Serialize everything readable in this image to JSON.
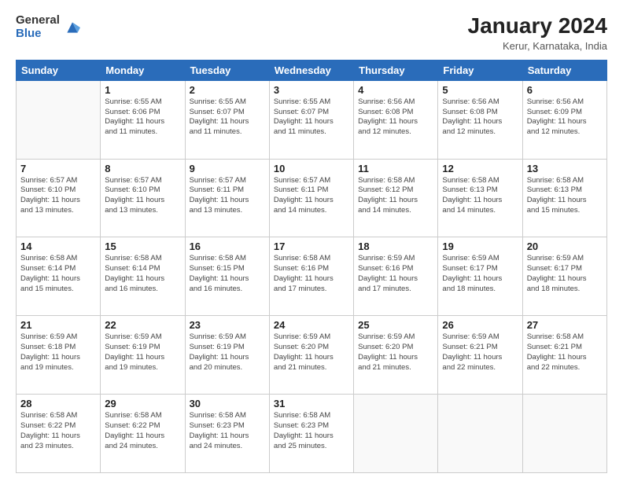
{
  "logo": {
    "general": "General",
    "blue": "Blue"
  },
  "title": "January 2024",
  "subtitle": "Kerur, Karnataka, India",
  "days_of_week": [
    "Sunday",
    "Monday",
    "Tuesday",
    "Wednesday",
    "Thursday",
    "Friday",
    "Saturday"
  ],
  "weeks": [
    [
      {
        "day": "",
        "info": ""
      },
      {
        "day": "1",
        "info": "Sunrise: 6:55 AM\nSunset: 6:06 PM\nDaylight: 11 hours\nand 11 minutes."
      },
      {
        "day": "2",
        "info": "Sunrise: 6:55 AM\nSunset: 6:07 PM\nDaylight: 11 hours\nand 11 minutes."
      },
      {
        "day": "3",
        "info": "Sunrise: 6:55 AM\nSunset: 6:07 PM\nDaylight: 11 hours\nand 11 minutes."
      },
      {
        "day": "4",
        "info": "Sunrise: 6:56 AM\nSunset: 6:08 PM\nDaylight: 11 hours\nand 12 minutes."
      },
      {
        "day": "5",
        "info": "Sunrise: 6:56 AM\nSunset: 6:08 PM\nDaylight: 11 hours\nand 12 minutes."
      },
      {
        "day": "6",
        "info": "Sunrise: 6:56 AM\nSunset: 6:09 PM\nDaylight: 11 hours\nand 12 minutes."
      }
    ],
    [
      {
        "day": "7",
        "info": "Sunrise: 6:57 AM\nSunset: 6:10 PM\nDaylight: 11 hours\nand 13 minutes."
      },
      {
        "day": "8",
        "info": "Sunrise: 6:57 AM\nSunset: 6:10 PM\nDaylight: 11 hours\nand 13 minutes."
      },
      {
        "day": "9",
        "info": "Sunrise: 6:57 AM\nSunset: 6:11 PM\nDaylight: 11 hours\nand 13 minutes."
      },
      {
        "day": "10",
        "info": "Sunrise: 6:57 AM\nSunset: 6:11 PM\nDaylight: 11 hours\nand 14 minutes."
      },
      {
        "day": "11",
        "info": "Sunrise: 6:58 AM\nSunset: 6:12 PM\nDaylight: 11 hours\nand 14 minutes."
      },
      {
        "day": "12",
        "info": "Sunrise: 6:58 AM\nSunset: 6:13 PM\nDaylight: 11 hours\nand 14 minutes."
      },
      {
        "day": "13",
        "info": "Sunrise: 6:58 AM\nSunset: 6:13 PM\nDaylight: 11 hours\nand 15 minutes."
      }
    ],
    [
      {
        "day": "14",
        "info": "Sunrise: 6:58 AM\nSunset: 6:14 PM\nDaylight: 11 hours\nand 15 minutes."
      },
      {
        "day": "15",
        "info": "Sunrise: 6:58 AM\nSunset: 6:14 PM\nDaylight: 11 hours\nand 16 minutes."
      },
      {
        "day": "16",
        "info": "Sunrise: 6:58 AM\nSunset: 6:15 PM\nDaylight: 11 hours\nand 16 minutes."
      },
      {
        "day": "17",
        "info": "Sunrise: 6:58 AM\nSunset: 6:16 PM\nDaylight: 11 hours\nand 17 minutes."
      },
      {
        "day": "18",
        "info": "Sunrise: 6:59 AM\nSunset: 6:16 PM\nDaylight: 11 hours\nand 17 minutes."
      },
      {
        "day": "19",
        "info": "Sunrise: 6:59 AM\nSunset: 6:17 PM\nDaylight: 11 hours\nand 18 minutes."
      },
      {
        "day": "20",
        "info": "Sunrise: 6:59 AM\nSunset: 6:17 PM\nDaylight: 11 hours\nand 18 minutes."
      }
    ],
    [
      {
        "day": "21",
        "info": "Sunrise: 6:59 AM\nSunset: 6:18 PM\nDaylight: 11 hours\nand 19 minutes."
      },
      {
        "day": "22",
        "info": "Sunrise: 6:59 AM\nSunset: 6:19 PM\nDaylight: 11 hours\nand 19 minutes."
      },
      {
        "day": "23",
        "info": "Sunrise: 6:59 AM\nSunset: 6:19 PM\nDaylight: 11 hours\nand 20 minutes."
      },
      {
        "day": "24",
        "info": "Sunrise: 6:59 AM\nSunset: 6:20 PM\nDaylight: 11 hours\nand 21 minutes."
      },
      {
        "day": "25",
        "info": "Sunrise: 6:59 AM\nSunset: 6:20 PM\nDaylight: 11 hours\nand 21 minutes."
      },
      {
        "day": "26",
        "info": "Sunrise: 6:59 AM\nSunset: 6:21 PM\nDaylight: 11 hours\nand 22 minutes."
      },
      {
        "day": "27",
        "info": "Sunrise: 6:58 AM\nSunset: 6:21 PM\nDaylight: 11 hours\nand 22 minutes."
      }
    ],
    [
      {
        "day": "28",
        "info": "Sunrise: 6:58 AM\nSunset: 6:22 PM\nDaylight: 11 hours\nand 23 minutes."
      },
      {
        "day": "29",
        "info": "Sunrise: 6:58 AM\nSunset: 6:22 PM\nDaylight: 11 hours\nand 24 minutes."
      },
      {
        "day": "30",
        "info": "Sunrise: 6:58 AM\nSunset: 6:23 PM\nDaylight: 11 hours\nand 24 minutes."
      },
      {
        "day": "31",
        "info": "Sunrise: 6:58 AM\nSunset: 6:23 PM\nDaylight: 11 hours\nand 25 minutes."
      },
      {
        "day": "",
        "info": ""
      },
      {
        "day": "",
        "info": ""
      },
      {
        "day": "",
        "info": ""
      }
    ]
  ]
}
